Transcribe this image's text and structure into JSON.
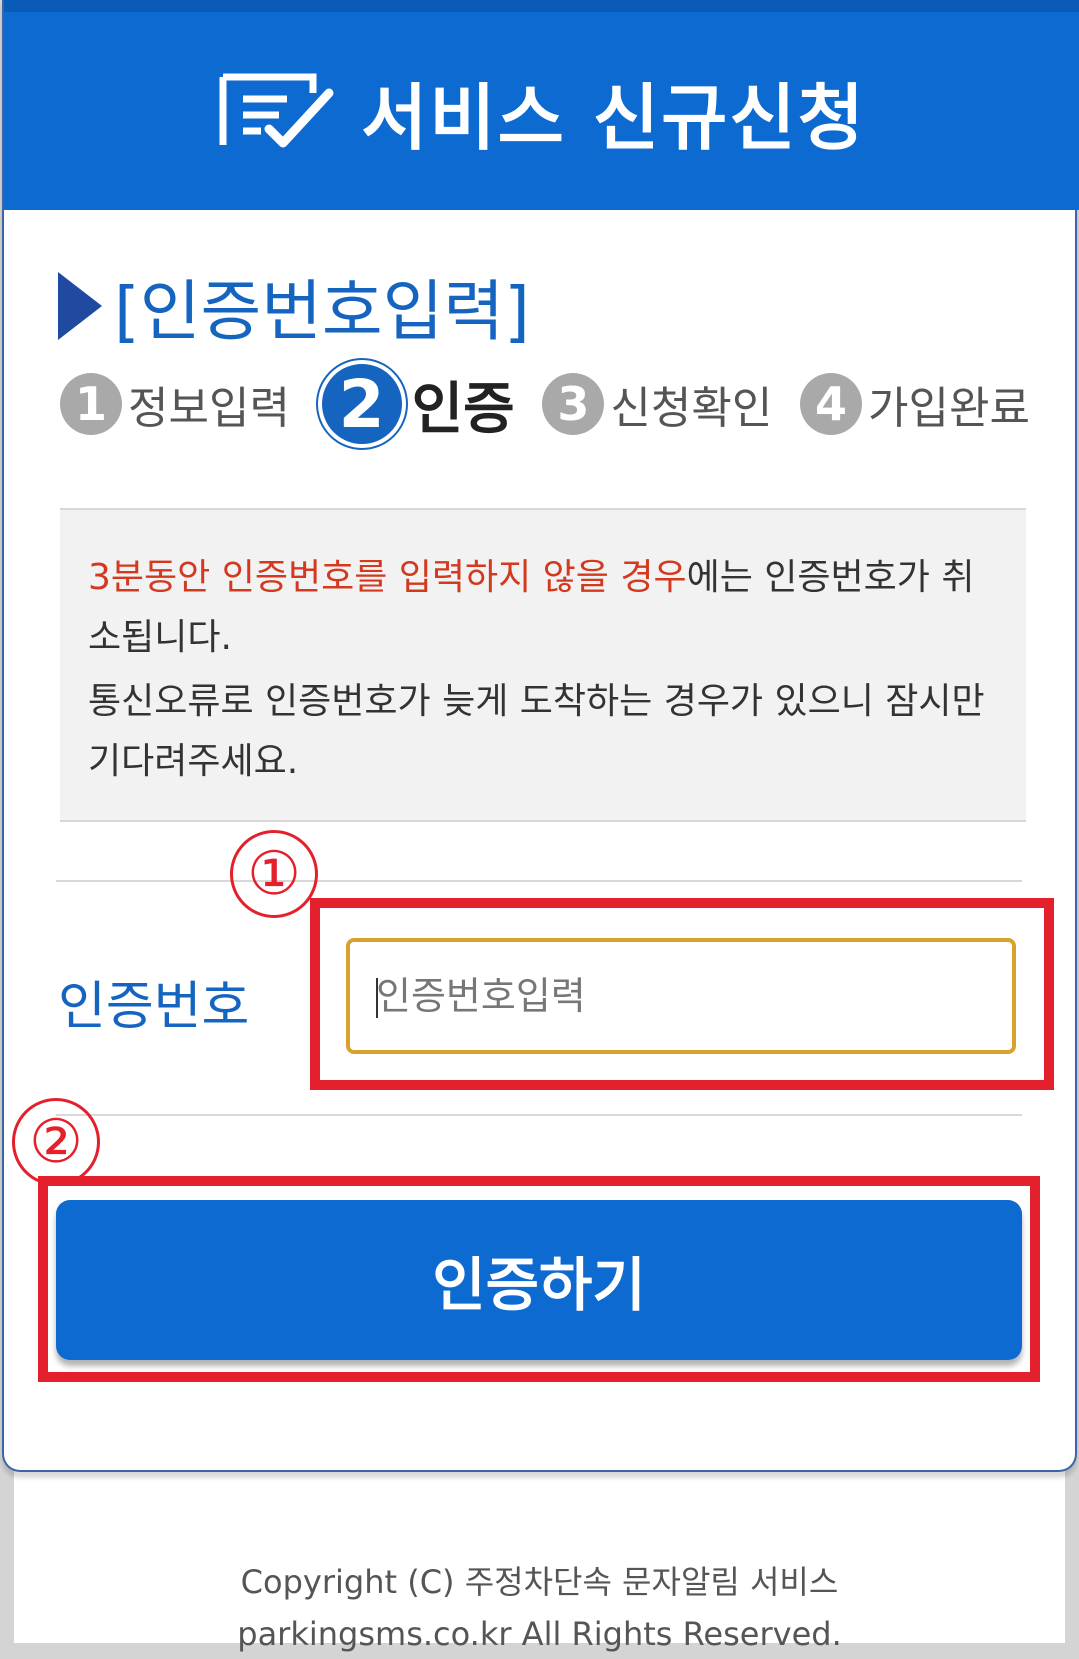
{
  "header": {
    "title": "서비스 신규신청",
    "icon": "form-check-icon"
  },
  "section": {
    "title": "[인증번호입력]"
  },
  "steps": [
    {
      "num": "1",
      "label": "정보입력",
      "active": false
    },
    {
      "num": "2",
      "label": "인증",
      "active": true
    },
    {
      "num": "3",
      "label": "신청확인",
      "active": false
    },
    {
      "num": "4",
      "label": "가입완료",
      "active": false
    }
  ],
  "notice": {
    "line1_red": "3분동안 인증번호를 입력하지 않을 경우",
    "line1_rest": "에는 인증번호가 취소됩니다.",
    "line2": "통신오류로 인증번호가 늦게 도착하는 경우가 있으니 잠시만 기다려주세요."
  },
  "form": {
    "label": "인증번호",
    "placeholder": "인증번호입력"
  },
  "button": {
    "label": "인증하기"
  },
  "annotations": {
    "mark1": "①",
    "mark2": "②"
  },
  "footer": {
    "line1": "Copyright (C) 주정차단속 문자알림 서비스",
    "line2": "parkingsms.co.kr All Rights Reserved."
  },
  "colors": {
    "brand_blue": "#0d6ad1",
    "title_blue": "#1565c0",
    "warning_red": "#d2391f",
    "highlight_red": "#e3202b",
    "input_border": "#d8a32d"
  }
}
